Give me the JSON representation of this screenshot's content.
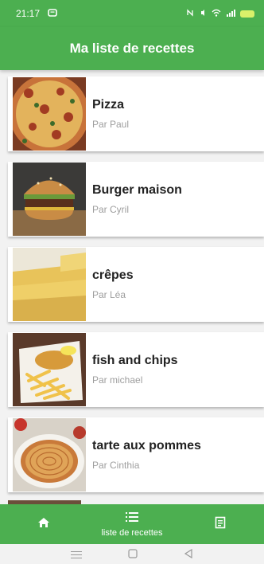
{
  "status": {
    "time": "21:17",
    "icons": "\u0004 \u0013 \u0011 .\u0001l"
  },
  "app_bar": {
    "title": "Ma liste de recettes"
  },
  "recipes": [
    {
      "title": "Pizza",
      "author": "Par Paul"
    },
    {
      "title": "Burger maison",
      "author": "Par Cyril"
    },
    {
      "title": "crêpes",
      "author": "Par Léa"
    },
    {
      "title": "fish and chips",
      "author": "Par michael"
    },
    {
      "title": "tarte aux pommes",
      "author": "Par Cinthia"
    }
  ],
  "bottom_nav": {
    "home_icon": "home-icon",
    "list_label": "liste de recettes",
    "list_icon": "list-icon",
    "receipt_icon": "receipt-icon"
  },
  "colors": {
    "primary": "#4caf50"
  }
}
